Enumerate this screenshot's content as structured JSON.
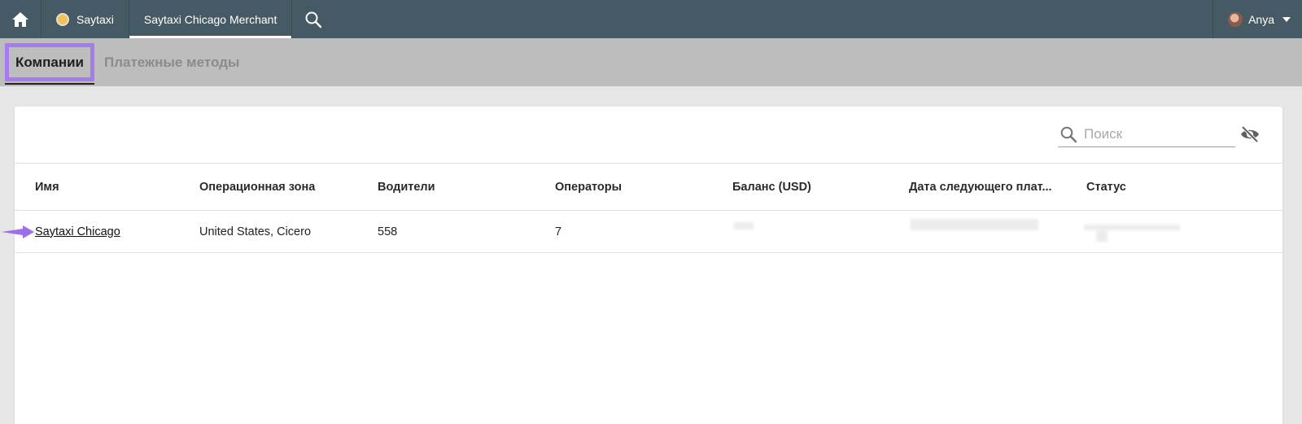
{
  "topbar": {
    "brand_label": "Saytaxi",
    "active_tab_label": "Saytaxi Chicago Merchant",
    "user_name": "Anya"
  },
  "subtabs": {
    "companies": "Компании",
    "payment_methods": "Платежные методы"
  },
  "search": {
    "placeholder": "Поиск"
  },
  "table": {
    "columns": [
      "Имя",
      "Операционная зона",
      "Водители",
      "Операторы",
      "Баланс (USD)",
      "Дата следующего плат...",
      "Статус"
    ],
    "rows": [
      {
        "name": "Saytaxi Chicago",
        "zone": "United States, Cicero",
        "drivers": "558",
        "operators": "7"
      }
    ]
  },
  "colors": {
    "topbar": "#465a65",
    "highlight": "#a67bf0",
    "subtabs_bg": "#bdbdbd"
  }
}
